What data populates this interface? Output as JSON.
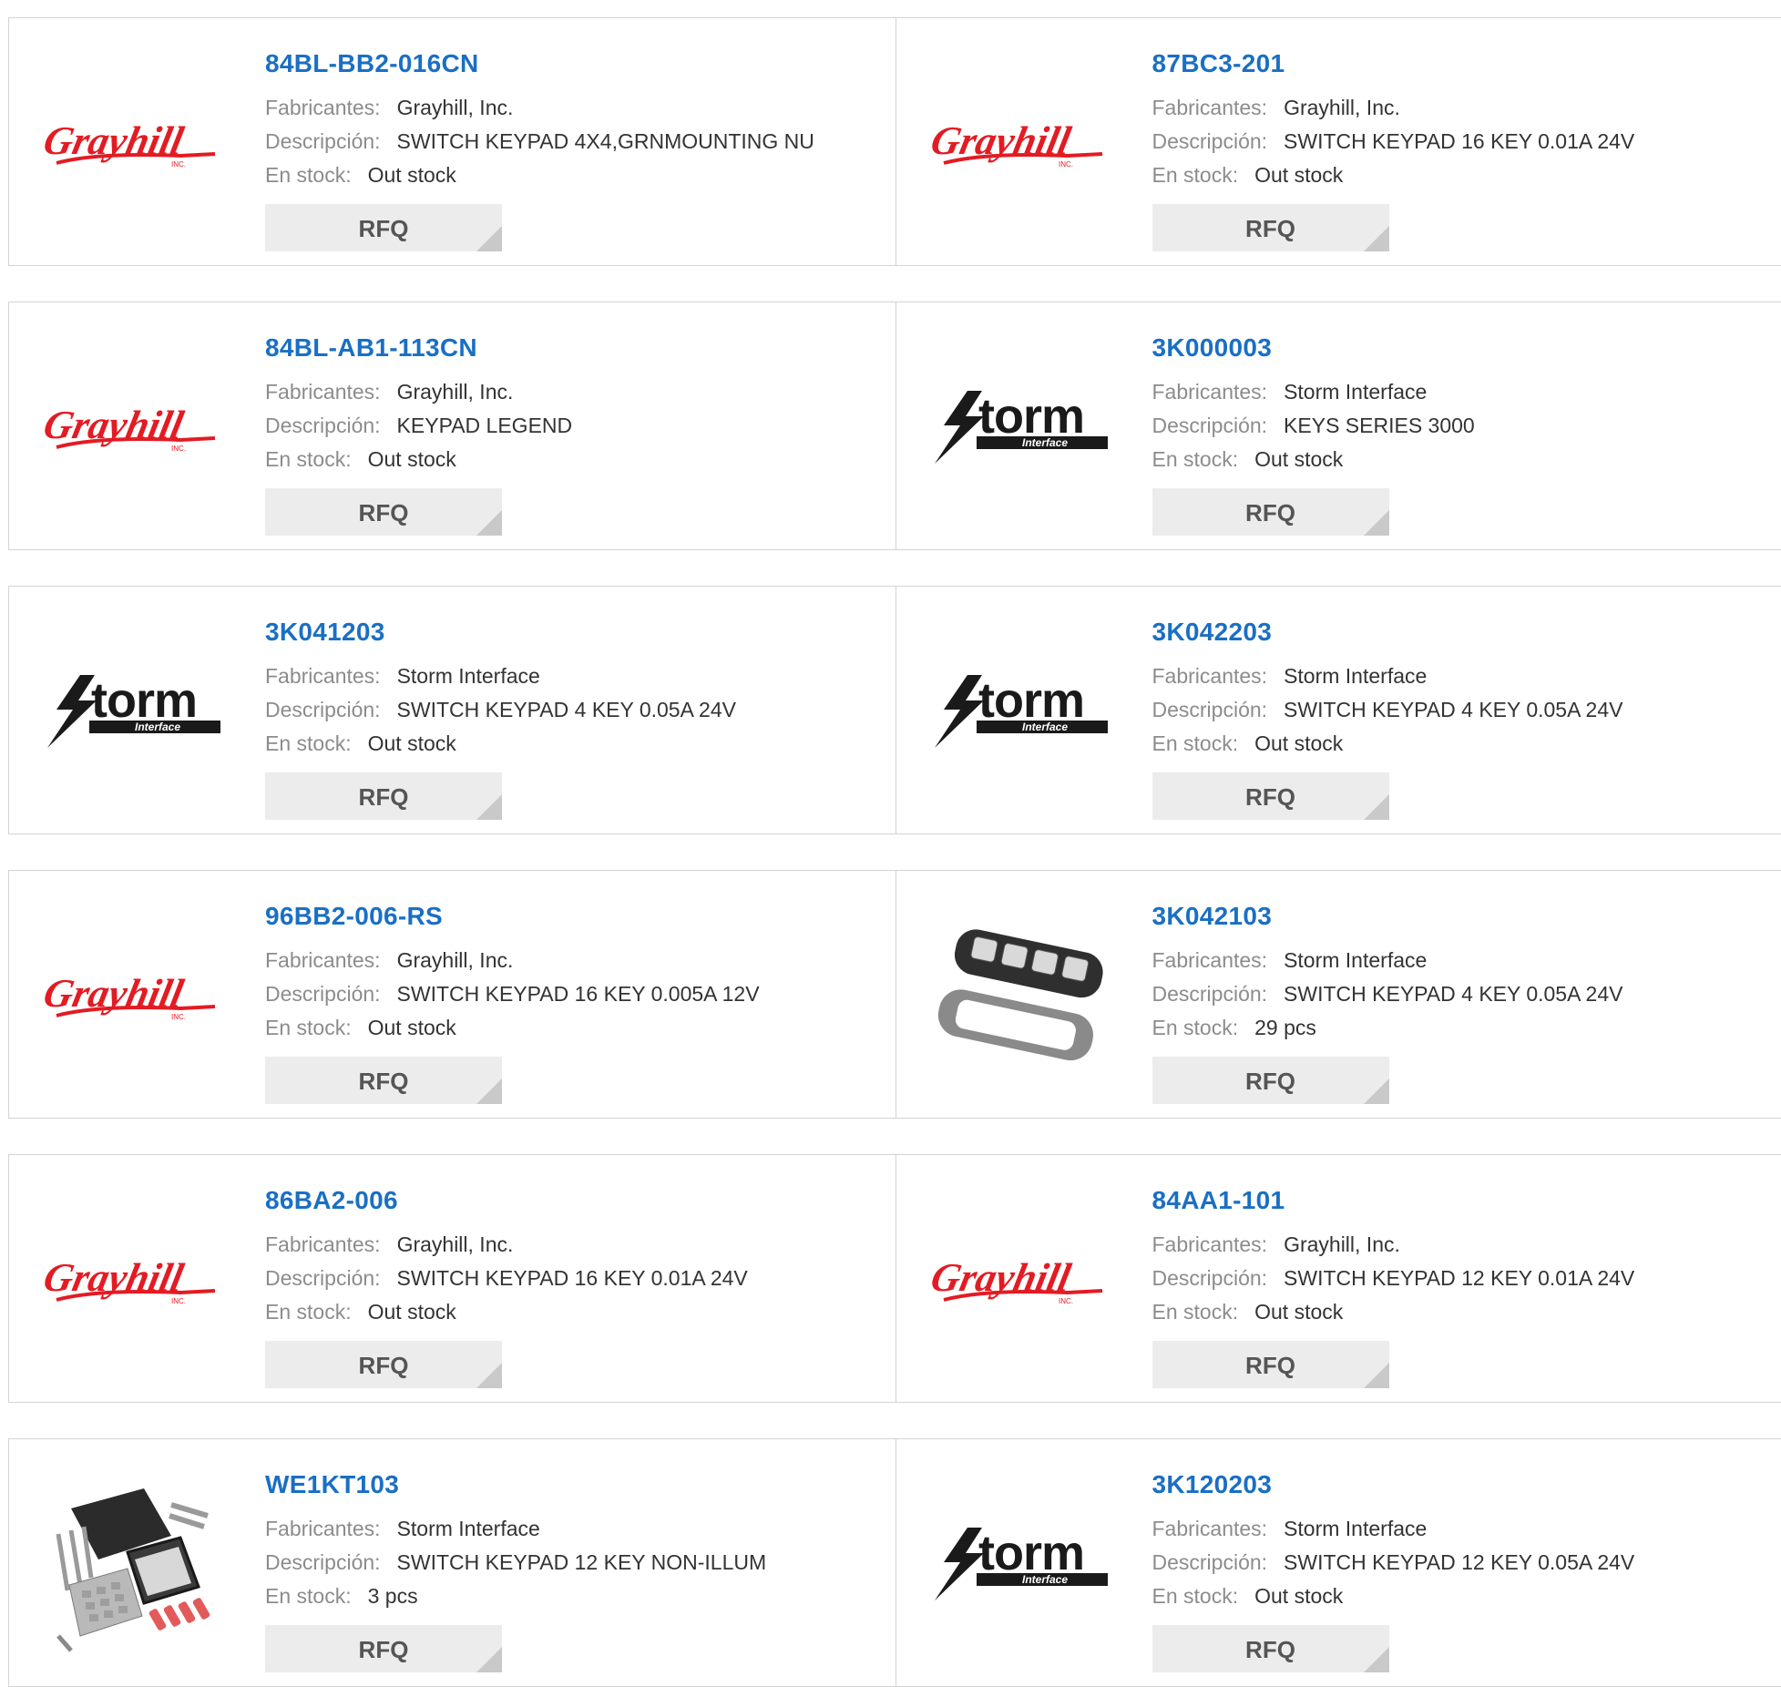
{
  "labels": {
    "manufacturer": "Fabricantes:",
    "description": "Descripción:",
    "stock": "En stock:",
    "rfq": "RFQ"
  },
  "products": [
    {
      "pn": "84BL-BB2-016CN",
      "mfr": "Grayhill, Inc.",
      "desc": "SWITCH KEYPAD 4X4,GRNMOUNTING NU",
      "stock": "Out stock",
      "image": "grayhill-logo"
    },
    {
      "pn": "87BC3-201",
      "mfr": "Grayhill, Inc.",
      "desc": "SWITCH KEYPAD 16 KEY 0.01A 24V",
      "stock": "Out stock",
      "image": "grayhill-logo"
    },
    {
      "pn": "84BL-AB1-113CN",
      "mfr": "Grayhill, Inc.",
      "desc": "KEYPAD LEGEND",
      "stock": "Out stock",
      "image": "grayhill-logo"
    },
    {
      "pn": "3K000003",
      "mfr": "Storm Interface",
      "desc": "KEYS SERIES 3000",
      "stock": "Out stock",
      "image": "storm-interface-logo"
    },
    {
      "pn": "3K041203",
      "mfr": "Storm Interface",
      "desc": "SWITCH KEYPAD 4 KEY 0.05A 24V",
      "stock": "Out stock",
      "image": "storm-interface-logo"
    },
    {
      "pn": "3K042203",
      "mfr": "Storm Interface",
      "desc": "SWITCH KEYPAD 4 KEY 0.05A 24V",
      "stock": "Out stock",
      "image": "storm-interface-logo"
    },
    {
      "pn": "96BB2-006-RS",
      "mfr": "Grayhill, Inc.",
      "desc": "SWITCH KEYPAD 16 KEY 0.005A 12V",
      "stock": "Out stock",
      "image": "grayhill-logo"
    },
    {
      "pn": "3K042103",
      "mfr": "Storm Interface",
      "desc": "SWITCH KEYPAD 4 KEY 0.05A 24V",
      "stock": "29 pcs",
      "image": "keypad-4key-photo"
    },
    {
      "pn": "86BA2-006",
      "mfr": "Grayhill, Inc.",
      "desc": "SWITCH KEYPAD 16 KEY 0.01A 24V",
      "stock": "Out stock",
      "image": "grayhill-logo"
    },
    {
      "pn": "84AA1-101",
      "mfr": "Grayhill, Inc.",
      "desc": "SWITCH KEYPAD 12 KEY 0.01A 24V",
      "stock": "Out stock",
      "image": "grayhill-logo"
    },
    {
      "pn": "WE1KT103",
      "mfr": "Storm Interface",
      "desc": "SWITCH KEYPAD 12 KEY NON-ILLUM",
      "stock": "3 pcs",
      "image": "keypad-kit-photo"
    },
    {
      "pn": "3K120203",
      "mfr": "Storm Interface",
      "desc": "SWITCH KEYPAD 12 KEY 0.05A 24V",
      "stock": "Out stock",
      "image": "storm-interface-logo"
    }
  ],
  "logo_text": {
    "grayhill": "Grayhill",
    "grayhill_inc": "INC.",
    "storm": "torm",
    "storm_sub": "Interface"
  },
  "colors": {
    "part_number": "#1a6fc4",
    "grayhill_red": "#e31b23",
    "rfq_bg": "#ececec"
  }
}
